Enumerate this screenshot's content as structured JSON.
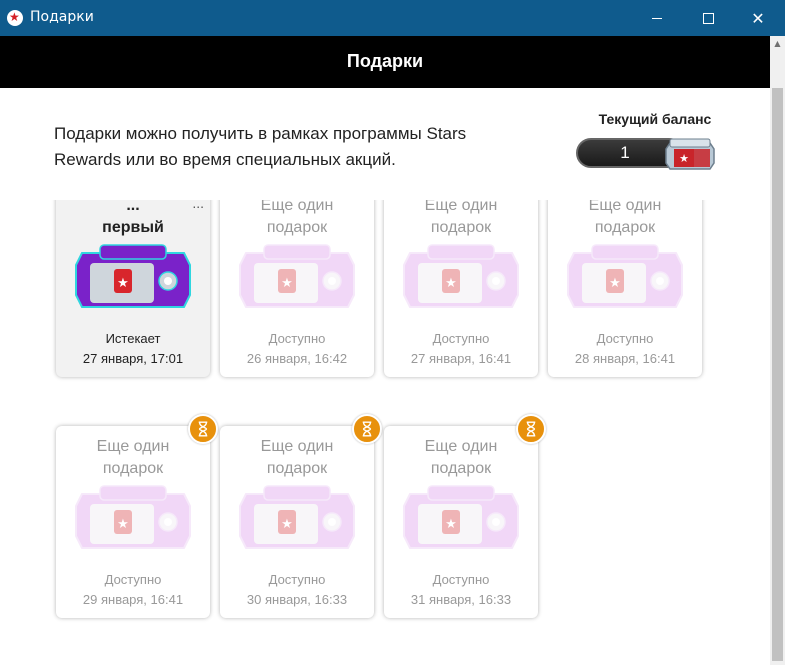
{
  "window": {
    "title": "Подарки",
    "icon": "pokerstars-logo-icon"
  },
  "header": {
    "title": "Подарки"
  },
  "intro": {
    "text": "Подарки можно получить в рамках программы Stars Rewards или во время специальных акций."
  },
  "balance": {
    "label": "Текущий баланс",
    "value": "1",
    "icon": "chest-icon"
  },
  "colors": {
    "titlebar": "#0f5b8d",
    "header": "#000000",
    "timer_badge": "#e8910c",
    "chest_active": "#7a22c9",
    "chest_locked": "#e6b8f2"
  },
  "cards": [
    {
      "title": "первый",
      "title_partial_top": "...",
      "more": "...",
      "status": "Истекает",
      "date": "27 января, 17:01",
      "state": "active",
      "timer": false
    },
    {
      "title": "подарок",
      "title_partial_top": "Еще один",
      "status": "Доступно",
      "date": "26 января, 16:42",
      "state": "locked",
      "timer": false
    },
    {
      "title": "подарок",
      "title_partial_top": "Еще один",
      "status": "Доступно",
      "date": "27 января, 16:41",
      "state": "locked",
      "timer": false
    },
    {
      "title": "подарок",
      "title_partial_top": "Еще один",
      "status": "Доступно",
      "date": "28 января, 16:41",
      "state": "locked",
      "timer": false
    },
    {
      "title": "Еще один подарок",
      "status": "Доступно",
      "date": "29 января, 16:41",
      "state": "locked",
      "timer": true
    },
    {
      "title": "Еще один подарок",
      "status": "Доступно",
      "date": "30 января, 16:33",
      "state": "locked",
      "timer": true
    },
    {
      "title": "Еще один подарок",
      "status": "Доступно",
      "date": "31 января, 16:33",
      "state": "locked",
      "timer": true
    }
  ]
}
